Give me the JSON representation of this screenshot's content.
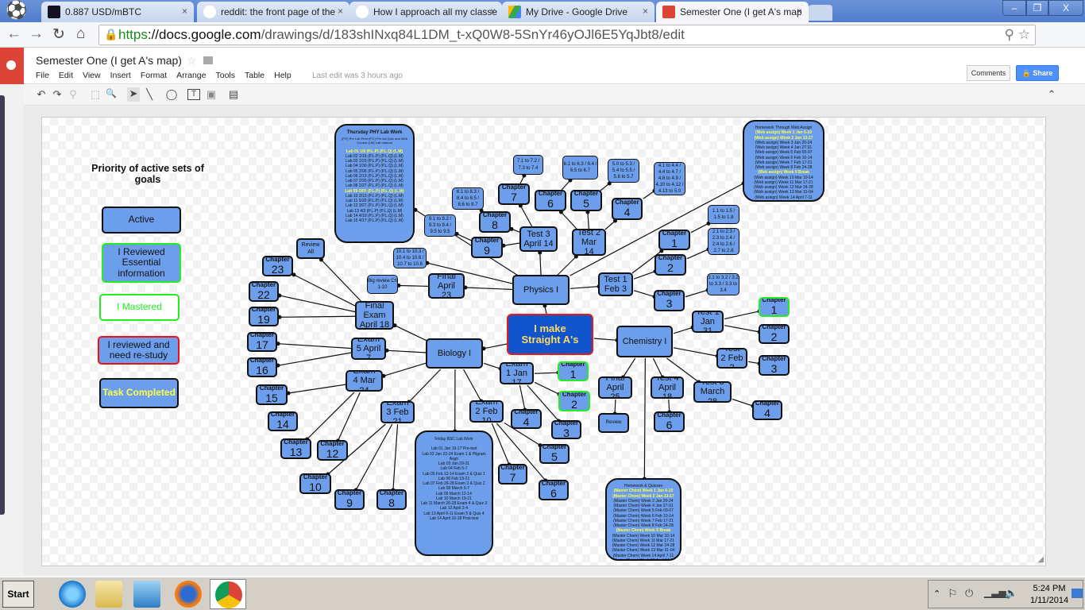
{
  "browser": {
    "tabs": [
      {
        "label": "0.887 USD/mBTC",
        "icon": "chart-icon",
        "active": false
      },
      {
        "label": "reddit: the front page of the",
        "icon": "reddit-icon",
        "active": false
      },
      {
        "label": "How I approach all my classe",
        "icon": "reddit-icon",
        "active": false
      },
      {
        "label": "My Drive - Google Drive",
        "icon": "drive-icon",
        "active": false
      },
      {
        "label": "Semester One (I get A's map",
        "icon": "drawings-icon",
        "active": true
      }
    ],
    "close_glyph": "×",
    "url_scheme": "https",
    "url_domain": "://docs.google.com",
    "url_path": "/drawings/d/183shINxq84L1DM_t-xQ0W8-5SnYr46yOJl6E5YqJbt8/edit",
    "window_controls": {
      "minimize": "–",
      "restore": "❐",
      "close": "X"
    }
  },
  "doc": {
    "title": "Semester One (I get A's map)",
    "star": "☆",
    "menu": [
      "File",
      "Edit",
      "View",
      "Insert",
      "Format",
      "Arrange",
      "Tools",
      "Table",
      "Help"
    ],
    "last_edit": "Last edit was 3 hours ago",
    "comments_label": "Comments",
    "share_label": "Share",
    "share_icon": "🔒"
  },
  "toolbar": {
    "undo": "↶",
    "redo": "↷",
    "paint": "⚲",
    "fit": "⬚",
    "zoom": "🔍",
    "select": "➤",
    "line": "╲",
    "shape": "◯",
    "textbox": "T",
    "image": "▣",
    "comment": "▤",
    "collapse": "⌃"
  },
  "legend": {
    "title": "Priority of active sets of goals",
    "items": [
      {
        "label": "Active",
        "style": "active"
      },
      {
        "label": "I Reviewed Essential information",
        "style": "reviewed"
      },
      {
        "label": "I Mastered",
        "style": "mastered"
      },
      {
        "label": "I reviewed and need re-study",
        "style": "restudy"
      },
      {
        "label": "Task Completed",
        "style": "completed"
      }
    ]
  },
  "diagram": {
    "root": "I make Straight A's",
    "chapter_word": "Chapter",
    "subjects": {
      "physics": "Physics I",
      "biology": "Biology I",
      "chemistry": "Chemistry I"
    },
    "physics": {
      "test1": "Test 1 Feb 3",
      "test2": "Test 2 Mar 14",
      "test3": "Test 3 April 14",
      "final": "Final April 23",
      "ch1_sections": "1.1 to 1.5 / 1.5 to 1.8",
      "ch2_sections": "2.1 to 2.3 / 2.3 to 2.4 / 2.4 to 2.6 / 2.7 to 2.8",
      "ch3_sections": "3.1 to 3.2 / 3.2 to 3.3 / 3.3 to 3.4",
      "ch4_sections": "4.1 to 4.4 / 4.4 to 4.7 / 4.8 to 4.9 / 4.10 to 4.12 / 4.13 to 5.0",
      "ch5_sections": "5.0 to 5.3 / 5.4 to 5.5 / 5.6 to 5.7",
      "ch6_sections": "6.1 to 6.3 / 6.4 / 6.5 to 6.7",
      "ch7_sections": "7.1 to 7.2 / 7.3 to 7.4",
      "ch8_sections": "8.1 to 8.3 / 8.4 to 8.5 / 8.6 to 8.7",
      "ch9_sections": "9.1 to 9.2 / 9.3 to 9.4 / 9.5 to 9.5",
      "ch10_sections": "10.1 to 10.3 / 10.4 to 10.6 / 10.7 to 10.8",
      "big_review": "Big review Ch 1-10",
      "lab_title": "Thursday PHY Lab Work",
      "lab_subtitle": "(P.P) Pre Lab Print (P.C) Pre lab Quiz and Web Course (LM) Lab manual",
      "lab_rows": [
        {
          "text": "Lab 01 1/9 (P.L.P) (P.L.Q) (L.M)",
          "highlight": true
        },
        {
          "text": "Lab 02 1/16 (P.L.P) (P.L.Q) (L.M)",
          "highlight": false
        },
        {
          "text": "Lab 03 1/23 (P.L.P) (P.L.Q) (L.M)",
          "highlight": false
        },
        {
          "text": "Lab 04 1/30 (P.L.P) (P.L.Q) (L.M)",
          "highlight": false
        },
        {
          "text": "Lab 05 2/06 (P.L.P) (P.L.Q) (L.M)",
          "highlight": false
        },
        {
          "text": "Lab 06 2/13 (P.L.P) (P.L.Q) (L.M)",
          "highlight": false
        },
        {
          "text": "Lab 07 2/20 (P.L.P) (P.L.Q) (L.M)",
          "highlight": false
        },
        {
          "text": "Lab 08 2/27 (P.L.P) (P.L.Q) (L.M)",
          "highlight": false
        },
        {
          "text": "Lab 09 OFF (P.L.P) (P.L.Q) (L.M)",
          "highlight": true
        },
        {
          "text": "Lab 10 3/13 (P.L.P) (P.L.Q) (L.M)",
          "highlight": false
        },
        {
          "text": "Lab 11 3/20 (P.L.P) (P.L.Q) (L.M)",
          "highlight": false
        },
        {
          "text": "Lab 12 3/27 (P.L.P) (P.L.Q) (L.M)",
          "highlight": false
        },
        {
          "text": "Lab 13 4/3 (P.L.P) (P.L.Q) (L.M)",
          "highlight": false
        },
        {
          "text": "Lab 14 4/10 (P.L.P) (P.L.Q) (L.M)",
          "highlight": false
        },
        {
          "text": "Lab 15 4/17 (P.L.P) (P.L.Q) (L.M)",
          "highlight": false
        }
      ],
      "hw_title": "Homework Through Web Assign",
      "hw_rows": [
        {
          "text": "(Web assign) Week 1 Jan 6-10",
          "highlight": true
        },
        {
          "text": "(Web assign) Week 2 Jan 13-17",
          "highlight": true
        },
        {
          "text": "(Web assign) Week 3 Jan 20-24",
          "highlight": false
        },
        {
          "text": "(Web assign) Week 4 Jan 27-31",
          "highlight": false
        },
        {
          "text": "(Web assign) Week 5 Feb 03-07",
          "highlight": false
        },
        {
          "text": "(Web assign) Week 6 Feb 10-14",
          "highlight": false
        },
        {
          "text": "(Web assign) Week 7 Feb 17-21",
          "highlight": false
        },
        {
          "text": "(Web assign) Week 8 Feb 24-28",
          "highlight": false
        },
        {
          "text": "(Web assign) Week 9 Break",
          "highlight": true
        },
        {
          "text": "(Web assign) Week 10 Mar 10-14",
          "highlight": false
        },
        {
          "text": "(Web assign) Week 11 Mar 17-21",
          "highlight": false
        },
        {
          "text": "(Web assign) Week 12 Mar 24-28",
          "highlight": false
        },
        {
          "text": "(Web assign) Week 13 Mar 31-04",
          "highlight": false
        },
        {
          "text": "(Web assign) Week 14 April 7-11",
          "highlight": false
        },
        {
          "text": "(Web assign) Week 15 April 14-18",
          "highlight": false
        },
        {
          "text": "(Web assign) Week 16 April 21-23",
          "highlight": false
        }
      ]
    },
    "biology": {
      "exam1": "Exam 1 Jan 17",
      "exam2": "Exam 2 Feb 10",
      "exam3": "Exam 3 Feb 21",
      "exam4": "Exam 4 Mar 24",
      "exam5": "Exam 5 April 7",
      "final": "Final Exam April 18",
      "review_all": "Review All",
      "lab_title": "Friday BSC Lab Work",
      "lab_rows": [
        "Lab 01 Jan 15-17 Pre-test",
        "Lab 02 Jan 22-24 Exam 1 & Pilgram Asgn",
        "Lab 03 Jan 29-31",
        "Lab 04 Feb 5-7",
        "Lab 05 Feb 12-14 Exam 2 & Quiz 1",
        "Lab 06 Feb 19-21",
        "Lab 07 Feb 26-28 Exam 3 & Quiz 2",
        "Lab 08 March 5-7",
        "Lab 09 March 12-14",
        "Lab 10 March 19-21",
        "Lab 11 March 26-28 Exam 4 & Quiz 3",
        "Lab 12 April 2-4",
        "Lab 13 April 9-11 Exam 5 & Quiz 4",
        "Lab 14 April 16-18 Post-test"
      ]
    },
    "chemistry": {
      "test1": "Test 1 Jan 31",
      "test2": "Test 2 Feb 2",
      "test3": "Test 3 March 28",
      "test4": "Test 4 April 18",
      "final": "Final April 25",
      "review": "Review",
      "hw_title": "Homework & Quizzes",
      "hw_rows": [
        {
          "text": "(Master Chem) Week 1 Jan 6-10",
          "highlight": true
        },
        {
          "text": "(Master Chem) Week 2 Jan 13-17",
          "highlight": true
        },
        {
          "text": "(Master Chem) Week 3 Jan 20-24",
          "highlight": false
        },
        {
          "text": "(Master Chem) Week 4 Jan 27-31",
          "highlight": false
        },
        {
          "text": "(Master Chem) Week 5 Feb 03-07",
          "highlight": false
        },
        {
          "text": "(Master Chem) Week 6 Feb 10-14",
          "highlight": false
        },
        {
          "text": "(Master Chem) Week 7 Feb 17-21",
          "highlight": false
        },
        {
          "text": "(Master Chem) Week 8 Feb 24-28",
          "highlight": false
        },
        {
          "text": "(Master Chem) Week 9 Break",
          "highlight": true
        },
        {
          "text": "(Master Chem) Week 10 Mar 10-14",
          "highlight": false
        },
        {
          "text": "(Master Chem) Week 11 Mar 17-21",
          "highlight": false
        },
        {
          "text": "(Master Chem) Week 12 Mar 24-28",
          "highlight": false
        },
        {
          "text": "(Master Chem) Week 13 Mar 31-04",
          "highlight": false
        },
        {
          "text": "(Master Chem) Week 14 April 7-11",
          "highlight": false
        },
        {
          "text": "(Master Chem) Week 15 April 14-18",
          "highlight": false
        },
        {
          "text": "(Master Chem) Week 16 April 21-23",
          "highlight": false
        }
      ]
    },
    "chapter_numbers": [
      "1",
      "2",
      "3",
      "4",
      "5",
      "6",
      "7",
      "8",
      "9",
      "10",
      "12",
      "13",
      "14",
      "15",
      "16",
      "17",
      "19",
      "22",
      "23"
    ]
  },
  "taskbar": {
    "start_label": "Start",
    "apps": [
      "internet-explorer",
      "windows-explorer",
      "media-player",
      "firefox",
      "chrome"
    ],
    "time": "5:24 PM",
    "date": "1/11/2014"
  }
}
